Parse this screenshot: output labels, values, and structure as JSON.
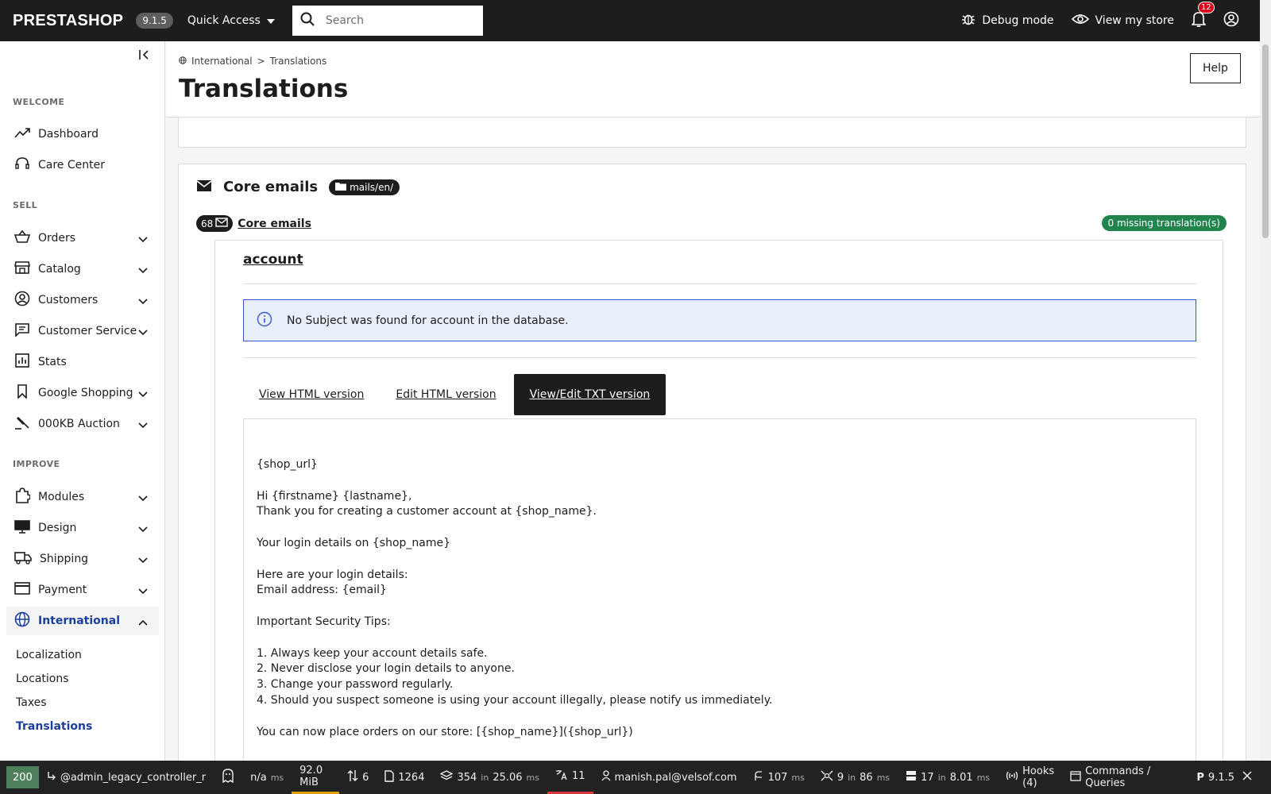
{
  "topbar": {
    "logo": "PRESTASHOP",
    "version": "9.1.5",
    "quick_access": "Quick Access",
    "search_placeholder": "Search",
    "debug_mode": "Debug mode",
    "view_store": "View my store",
    "notifications_count": "12"
  },
  "sidebar": {
    "sections": {
      "welcome": "WELCOME",
      "sell": "SELL",
      "improve": "IMPROVE"
    },
    "items": {
      "dashboard": "Dashboard",
      "care_center": "Care Center",
      "orders": "Orders",
      "catalog": "Catalog",
      "customers": "Customers",
      "customer_service": "Customer Service",
      "stats": "Stats",
      "google_shopping": "Google Shopping",
      "auction": "000KB Auction",
      "modules": "Modules",
      "design": "Design",
      "shipping": "Shipping",
      "payment": "Payment",
      "international": "International"
    },
    "sub_items": {
      "localization": "Localization",
      "locations": "Locations",
      "taxes": "Taxes",
      "translations": "Translations"
    }
  },
  "header": {
    "breadcrumb_parent": "International",
    "breadcrumb_sep": ">",
    "breadcrumb_current": "Translations",
    "title": "Translations",
    "help": "Help"
  },
  "content": {
    "core_emails_title": "Core emails",
    "folder": "mails/en/",
    "count": "68",
    "count_link": "Core emails",
    "missing": "0 missing translation(s)",
    "account_title": "account",
    "alert": "No Subject was found for account in the database.",
    "tabs": {
      "view_html": "View HTML version",
      "edit_html": "Edit HTML version",
      "edit_txt": "View/Edit TXT version"
    },
    "txt_body": "{shop_url}\n\nHi {firstname} {lastname},\nThank you for creating a customer account at {shop_name}.\n\nYour login details on {shop_name}\n\nHere are your login details:\nEmail address: {email}\n\nImportant Security Tips:\n\n1. Always keep your account details safe.\n2. Never disclose your login details to anyone.\n3. Change your password regularly.\n4. Should you suspect someone is using your account illegally, please notify us immediately.\n\nYou can now place orders on our store: [{shop_name}]({shop_url})"
  },
  "debugbar": {
    "status": "200",
    "route": "@admin_legacy_controller_r",
    "time_value": "n/a",
    "time_unit": "ms",
    "memory": "92.0 MiB",
    "requests": "6",
    "files": "1264",
    "db_count": "354",
    "db_in": "in",
    "db_time": "25.06",
    "db_unit": "ms",
    "translations": "11",
    "user": "manish.pal@velsof.com",
    "ajax_time": "107",
    "ajax_unit": "ms",
    "events": "9",
    "events_in": "in",
    "events_time": "86",
    "events_unit": "ms",
    "cache": "17",
    "cache_in": "in",
    "cache_time": "8.01",
    "cache_unit": "ms",
    "hooks": "Hooks (4)",
    "commands": "Commands / Queries",
    "version": "9.1.5"
  }
}
